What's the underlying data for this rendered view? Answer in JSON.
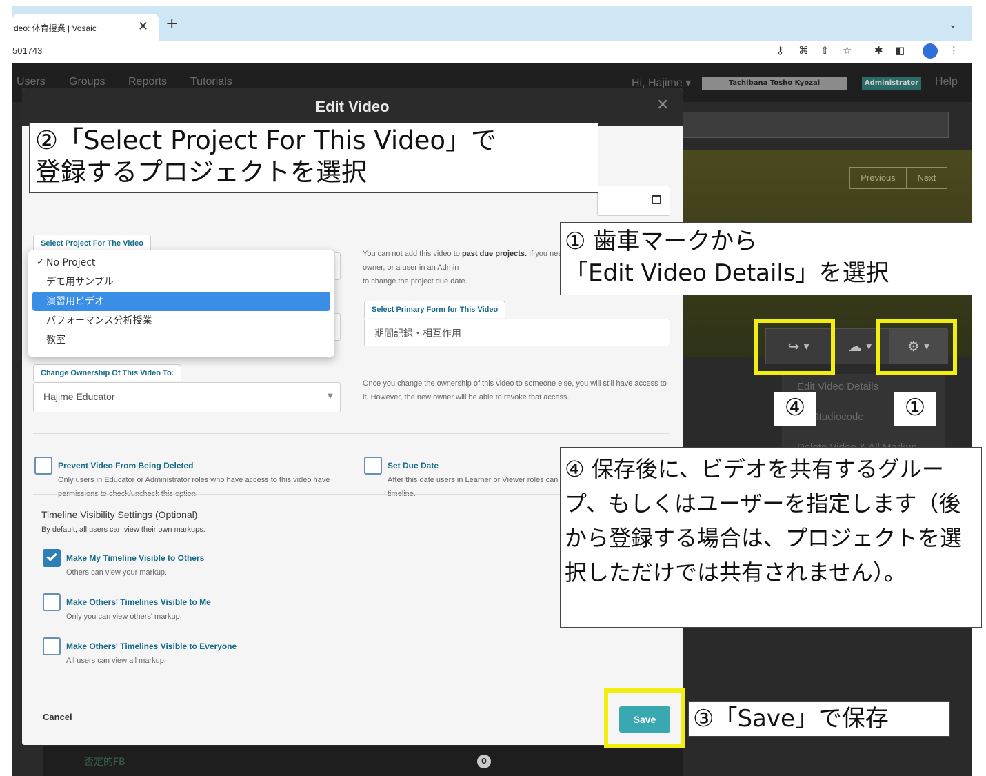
{
  "browser": {
    "tab_title": "deo: 体育授業 | Vosaic",
    "close_glyph": "✕",
    "new_tab_glyph": "+",
    "tab_menu_glyph": "⌄",
    "url": "501743",
    "toolbar_icons": [
      "key-icon",
      "translate-icon",
      "share-page-icon",
      "bookmark-star-icon",
      "extensions-icon",
      "sidepanel-icon",
      "profile-icon",
      "more-menu-icon"
    ]
  },
  "app": {
    "nav": [
      "Users",
      "Groups",
      "Reports",
      "Tutorials"
    ],
    "greeting": "Hi, Hajime ▾",
    "org_name": "Tachibana Tosho Kyozai",
    "role": "Administrator",
    "help": "Help",
    "previous": "Previous",
    "next": "Next",
    "gear_menu": [
      "Edit Video Details",
      "ort Studiocode",
      "Delete Video & All Markup"
    ],
    "bottom_label": "否定的FB",
    "bottom_count": "0"
  },
  "modal": {
    "title": "Edit Video",
    "close_glyph": "✕",
    "project": {
      "tab_label": "Select Project For The Video",
      "options": [
        "No Project",
        "デモ用サンプル",
        "演習用ビデオ",
        "パフォーマンス分析授業",
        "教室"
      ],
      "checked_glyph": "✓",
      "checked_index": 0,
      "highlighted_index": 2
    },
    "project_help_html": "You can not add this video to <b>past due projects.</b> If you need to, please contact the project owner, or a user in an Admin",
    "project_help_line3": "to change the project due date.",
    "primary_form": {
      "tab_label": "Select Primary Form for This Video",
      "value": "期間記録・相互作用"
    },
    "ownership": {
      "tab_label": "Change Ownership Of This Video To:",
      "value": "Hajime Educator",
      "help": "Once you change the ownership of this video to someone else, you will still have access to it. However, the new owner will be able to revoke that access."
    },
    "prevent_delete": {
      "title": "Prevent Video From Being Deleted",
      "desc": "Only users in Educator or Administrator roles who have access to this video have permissions to check/uncheck this option.",
      "checked": false
    },
    "due_date": {
      "title": "Set Due Date",
      "desc": "After this date users in Learner or Viewer roles can no longer make changes to the timeline.",
      "checked": false
    },
    "timeline": {
      "heading": "Timeline Visibility Settings (Optional)",
      "subheading": "By default, all users can view their own markups.",
      "options": [
        {
          "title": "Make My Timeline Visible to Others",
          "desc": "Others can view your markup.",
          "checked": true
        },
        {
          "title": "Make Others' Timelines Visible to Me",
          "desc": "Only you can view others' markup.",
          "checked": false
        },
        {
          "title": "Make Others' Timelines Visible to Everyone",
          "desc": "All users can view all markup.",
          "checked": false
        }
      ]
    },
    "cancel": "Cancel",
    "save": "Save"
  },
  "annotations": {
    "step2": "②「Select Project For This Video」で\n登録するプロジェクトを選択",
    "step1": "① 歯車マークから\n「Edit Video Details」を選択",
    "step4": "④ 保存後に、ビデオを共有するグループ、もしくはユーザーを指定します（後から登録する場合は、プロジェクトを選択しただけでは共有されません）。",
    "step3": "③「Save」で保存",
    "marker4": "④",
    "marker1": "①",
    "highlight_color": "#f3ee11"
  }
}
